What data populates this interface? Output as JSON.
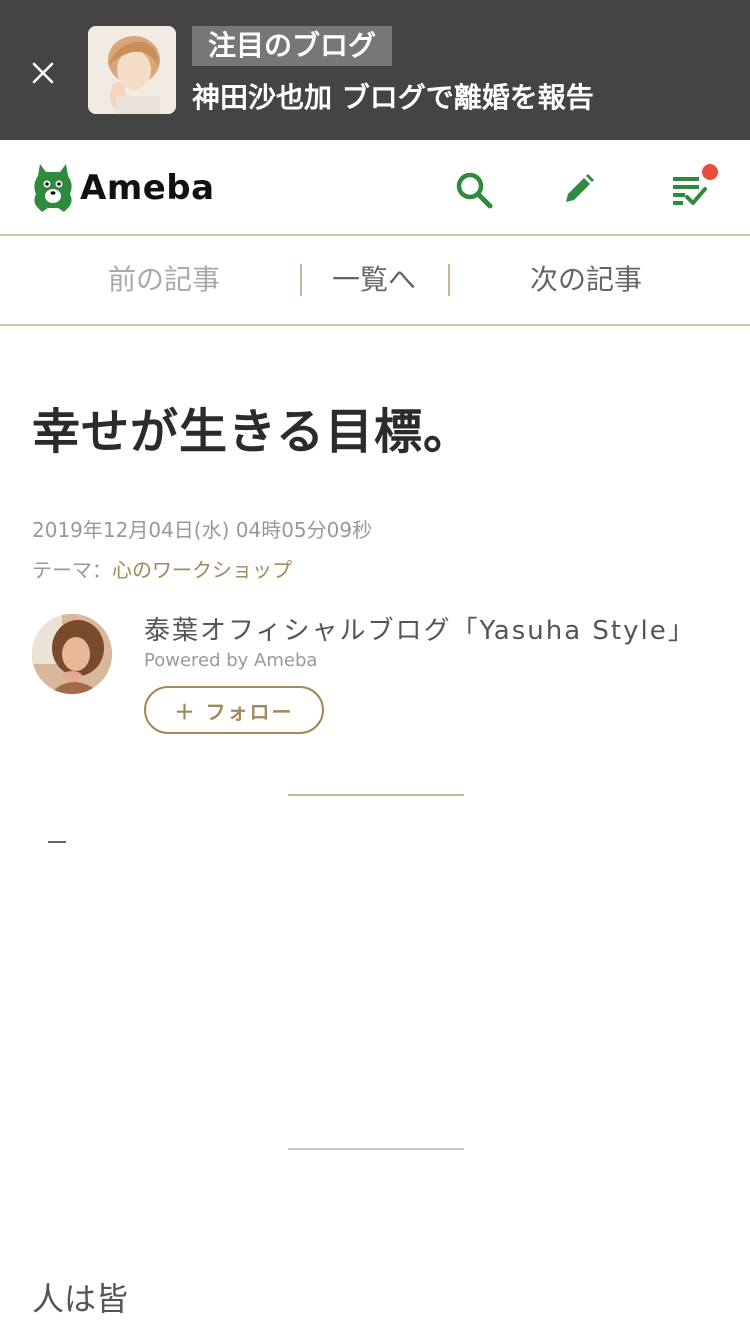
{
  "banner": {
    "tag": "注目のブログ",
    "headline": "神田沙也加 ブログで離婚を報告"
  },
  "header": {
    "logo_text": "Ameba",
    "icons": [
      "search-icon",
      "pencil-icon",
      "reader-list-icon"
    ],
    "accent_color": "#2e8b3d",
    "notification_color": "#e94e3c"
  },
  "article_nav": {
    "prev": "前の記事",
    "list": "一覧へ",
    "next": "次の記事"
  },
  "article": {
    "title": "幸せが生きる目標。",
    "date": "2019年12月04日(水) 04時05分09秒",
    "theme_label": "テーマ：",
    "theme_value": "心のワークショップ",
    "body_start": "人は皆"
  },
  "author": {
    "blog_name": "泰葉オフィシャルブログ「Yasuha Style」",
    "powered": "Powered by Ameba",
    "follow_label": "＋ フォロー"
  }
}
